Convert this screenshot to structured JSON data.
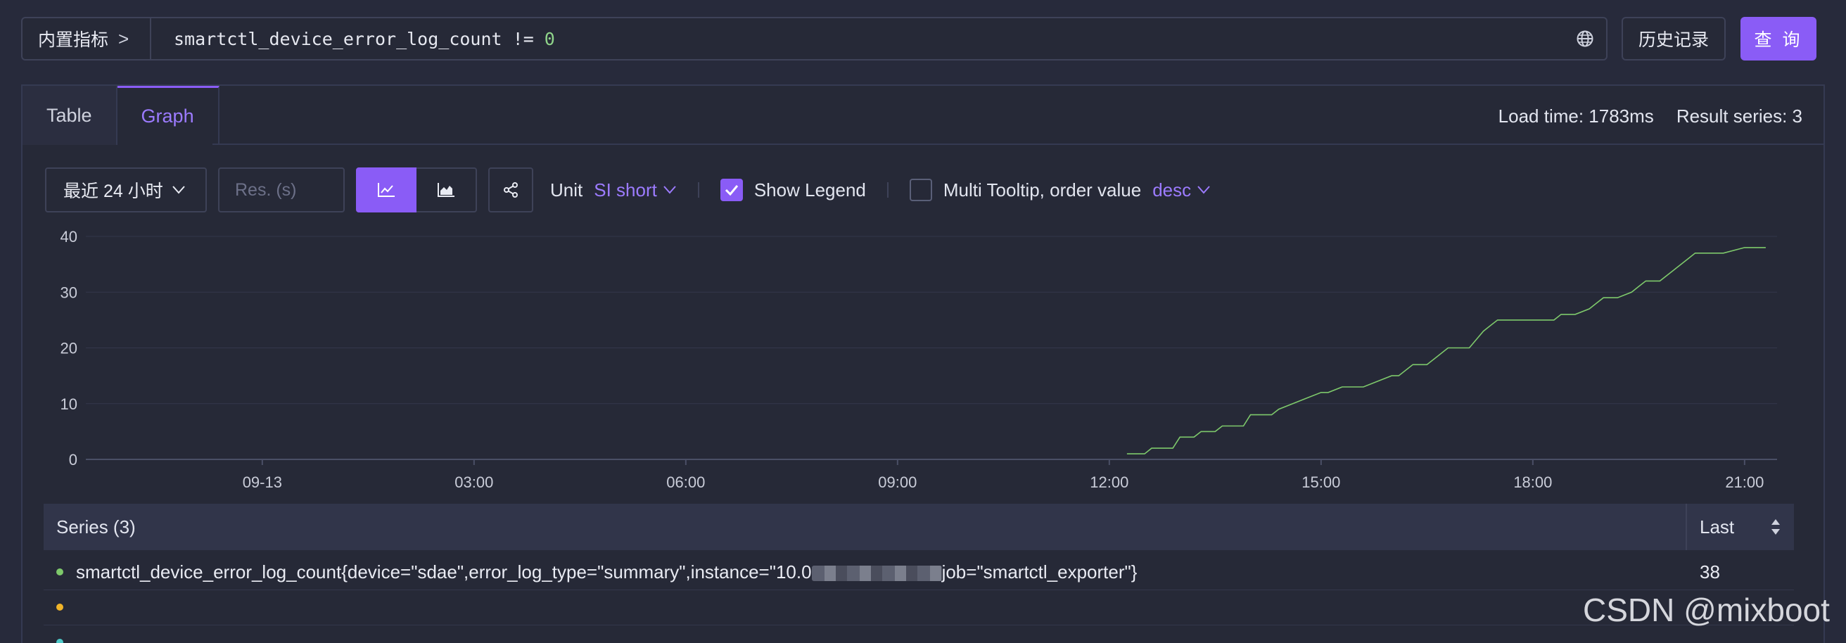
{
  "query_bar": {
    "builtin_label": "内置指标",
    "query_metric": "smartctl_device_error_log_count != ",
    "query_number": "0",
    "history_label": "历史记录",
    "query_button_label": "查 询"
  },
  "tabs": [
    {
      "label": "Table",
      "active": false
    },
    {
      "label": "Graph",
      "active": true
    }
  ],
  "meta": {
    "load_time": "Load time: 1783ms",
    "result_series": "Result series: 3"
  },
  "toolbar": {
    "range_label": "最近 24 小时",
    "res_placeholder": "Res. (s)",
    "unit_label": "Unit",
    "unit_value": "SI short",
    "show_legend_label": "Show Legend",
    "show_legend_checked": true,
    "multi_tooltip_label": "Multi Tooltip, order value",
    "multi_tooltip_checked": false,
    "order_value": "desc"
  },
  "chart_data": {
    "type": "line",
    "y_ticks": [
      0,
      10,
      20,
      30,
      40
    ],
    "ylim": [
      0,
      40
    ],
    "x_ticks": [
      "09-13",
      "03:00",
      "06:00",
      "09:00",
      "12:00",
      "15:00",
      "18:00",
      "21:00"
    ],
    "x_tick_hours": [
      0,
      3,
      6,
      9,
      12,
      15,
      18,
      21
    ],
    "xlim_hours": [
      -2.5,
      21.46
    ],
    "grid": true,
    "series": [
      {
        "color": "#7ec96b",
        "points": [
          [
            12.25,
            1
          ],
          [
            12.5,
            1
          ],
          [
            12.6,
            2
          ],
          [
            12.9,
            2
          ],
          [
            13.0,
            4
          ],
          [
            13.2,
            4
          ],
          [
            13.3,
            5
          ],
          [
            13.5,
            5
          ],
          [
            13.6,
            6
          ],
          [
            13.9,
            6
          ],
          [
            14.0,
            8
          ],
          [
            14.3,
            8
          ],
          [
            14.4,
            9
          ],
          [
            14.8,
            11
          ],
          [
            15.0,
            12
          ],
          [
            15.1,
            12
          ],
          [
            15.3,
            13
          ],
          [
            15.6,
            13
          ],
          [
            15.8,
            14
          ],
          [
            16.0,
            15
          ],
          [
            16.1,
            15
          ],
          [
            16.3,
            17
          ],
          [
            16.5,
            17
          ],
          [
            16.6,
            18
          ],
          [
            16.8,
            20
          ],
          [
            17.1,
            20
          ],
          [
            17.3,
            23
          ],
          [
            17.4,
            24
          ],
          [
            17.5,
            25
          ],
          [
            17.8,
            25
          ],
          [
            17.9,
            25
          ],
          [
            18.3,
            25
          ],
          [
            18.4,
            26
          ],
          [
            18.6,
            26
          ],
          [
            18.8,
            27
          ],
          [
            18.9,
            28
          ],
          [
            19.0,
            29
          ],
          [
            19.2,
            29
          ],
          [
            19.4,
            30
          ],
          [
            19.5,
            31
          ],
          [
            19.6,
            32
          ],
          [
            19.8,
            32
          ],
          [
            20.0,
            34
          ],
          [
            20.2,
            36
          ],
          [
            20.3,
            37
          ],
          [
            20.6,
            37
          ],
          [
            20.7,
            37
          ],
          [
            21.0,
            38
          ],
          [
            21.1,
            38
          ],
          [
            21.3,
            38
          ]
        ]
      }
    ]
  },
  "series_table": {
    "title": "Series (3)",
    "last_label": "Last",
    "rows": [
      {
        "color": "#7ec96b",
        "name_prefix": "smartctl_device_error_log_count{device=\"sdae\",error_log_type=\"summary\",instance=\"10.0",
        "name_suffix": "job=\"smartctl_exporter\"}",
        "last": "38"
      },
      {
        "color": "#f0b429",
        "name_prefix": "",
        "name_suffix": "",
        "last": ""
      },
      {
        "color": "#4ec9c9",
        "name_prefix": "",
        "name_suffix": "",
        "last": ""
      }
    ]
  },
  "watermark": "CSDN @mixboot"
}
